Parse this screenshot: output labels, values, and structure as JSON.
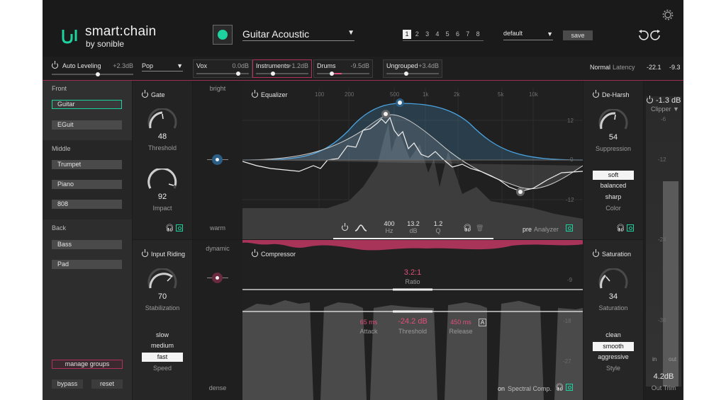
{
  "header": {
    "brand_name": "smart:chain",
    "brand_by": "by sonible",
    "preset_name": "Guitar Acoustic",
    "slots": [
      "1",
      "2",
      "3",
      "4",
      "5",
      "6",
      "7",
      "8"
    ],
    "active_slot": "1",
    "profile": "default",
    "save_label": "save"
  },
  "strip": {
    "auto_leveling": {
      "label": "Auto Leveling",
      "value": "+2.3dB",
      "level": 0.55
    },
    "genre": "Pop",
    "groups": [
      {
        "name": "Vox",
        "value": "0.0dB",
        "level": 0.8
      },
      {
        "name": "Instruments",
        "value": "+1.2dB",
        "level": 0.3
      },
      {
        "name": "Drums",
        "value": "-9.5dB",
        "level": 0.25
      },
      {
        "name": "Ungrouped",
        "value": "+3.4dB",
        "level": 0.35
      }
    ],
    "mode": "Normal",
    "latency_label": "Latency",
    "meter_left": "-22.1",
    "meter_right": "-9.3"
  },
  "sidebar": {
    "sections": [
      {
        "label": "Front",
        "items": [
          "Guitar",
          "EGuit"
        ]
      },
      {
        "label": "Middle",
        "items": [
          "Trumpet",
          "Piano",
          "808"
        ]
      },
      {
        "label": "Back",
        "items": [
          "Bass",
          "Pad"
        ]
      }
    ],
    "selected": "Guitar",
    "manage_groups": "manage groups",
    "bypass": "bypass",
    "reset": "reset"
  },
  "gate": {
    "title": "Gate",
    "threshold": {
      "value": "48",
      "label": "Threshold"
    },
    "impact": {
      "value": "92",
      "label": "Impact"
    }
  },
  "tone": {
    "top": "bright",
    "bottom": "warm"
  },
  "equalizer": {
    "title": "Equalizer",
    "freq_labels": [
      "100",
      "200",
      "500",
      "1k",
      "2k",
      "5k",
      "10k"
    ],
    "db_labels": [
      "12",
      "0",
      "-12"
    ],
    "band": {
      "hz": "400",
      "hz_label": "Hz",
      "db": "13.2",
      "db_label": "dB",
      "q": "1.2",
      "q_label": "Q"
    },
    "pre_label": "pre",
    "analyzer_label": "Analyzer"
  },
  "deharsh": {
    "title": "De-Harsh",
    "suppression": {
      "value": "54",
      "label": "Suppression"
    },
    "colors": [
      "soft",
      "balanced",
      "sharp"
    ],
    "selected_color": "soft",
    "color_label": "Color"
  },
  "clipper": {
    "value": "-1.3 dB",
    "label": "Clipper",
    "scale": [
      "-6",
      "-12",
      "-24",
      "-36"
    ],
    "in_label": "in",
    "out_label": "out",
    "out_trim": "4.2dB",
    "out_trim_label": "Out Trim"
  },
  "input_riding": {
    "title": "Input Riding",
    "stabilization": {
      "value": "70",
      "label": "Stabilization"
    },
    "speeds": [
      "slow",
      "medium",
      "fast"
    ],
    "selected_speed": "fast",
    "speed_label": "Speed"
  },
  "dynamic": {
    "top": "dynamic",
    "bottom": "dense"
  },
  "compressor": {
    "title": "Compressor",
    "ratio": {
      "value": "3.2:1",
      "label": "Ratio"
    },
    "attack": {
      "value": "65 ms",
      "label": "Attack"
    },
    "threshold": {
      "value": "-24.2 dB",
      "label": "Threshold"
    },
    "release": {
      "value": "450 ms",
      "label": "Release"
    },
    "auto_badge": "A",
    "scale": [
      "-9",
      "-18",
      "-27"
    ],
    "on_label": "on",
    "spectral_label": "Spectral Comp."
  },
  "saturation": {
    "title": "Saturation",
    "amount": {
      "value": "34",
      "label": "Saturation"
    },
    "styles": [
      "clean",
      "smooth",
      "aggressive"
    ],
    "selected_style": "smooth",
    "style_label": "Style"
  },
  "colors": {
    "accent": "#1ed2a0",
    "pink": "#e0507a",
    "blue": "#4aa3e0"
  }
}
